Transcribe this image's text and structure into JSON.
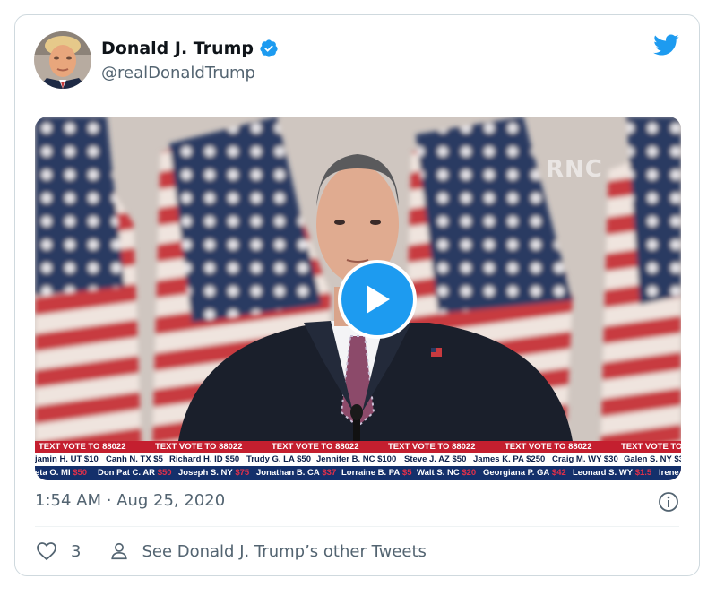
{
  "tweet": {
    "display_name": "Donald J. Trump",
    "handle": "@realDonaldTrump",
    "timestamp": "1:54 AM · Aug 25, 2020",
    "likes": "3",
    "other_tweets_link": "See Donald J. Trump’s other Tweets"
  },
  "video": {
    "watermark": "RNC",
    "ticker_banner": "TEXT VOTE TO 88022",
    "ticker_row2": [
      "jamin H. UT $10",
      "Canh N. TX $5",
      "Richard H. ID $50",
      "Trudy G. LA $50",
      "Jennifer B. NC $100",
      "Steve J. AZ $50",
      "James K. PA $250",
      "Craig M. WY $30",
      "Galen S. NY $3"
    ],
    "ticker_row3": [
      {
        "name": "eta O. MI",
        "amount": "$50"
      },
      {
        "name": "Don Pat C. AR",
        "amount": "$50"
      },
      {
        "name": "Joseph S. NY",
        "amount": "$75"
      },
      {
        "name": "Jonathan B. CA",
        "amount": "$37"
      },
      {
        "name": "Lorraine B. PA",
        "amount": "$5"
      },
      {
        "name": "Walt S. NC",
        "amount": "$20"
      },
      {
        "name": "Georgiana P. GA",
        "amount": "$42"
      },
      {
        "name": "Leonard S. WY",
        "amount": "$1.5"
      },
      {
        "name": "Irene",
        "amount": ""
      }
    ]
  },
  "colors": {
    "twitter_blue": "#1d9bf0",
    "text_primary": "#0f1419",
    "text_secondary": "#536471",
    "ticker_red": "#c41f2f",
    "ticker_navy": "#14306b"
  },
  "icons": [
    "twitter-bird-icon",
    "verified-badge-icon",
    "play-icon",
    "info-icon",
    "heart-icon",
    "person-icon"
  ]
}
